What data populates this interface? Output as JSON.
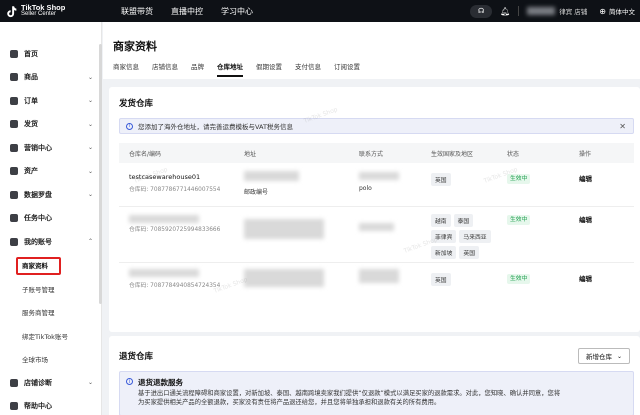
{
  "topbar": {
    "logo_line1": "TikTok Shop",
    "logo_line2": "Seller Center",
    "nav": [
      "联盟带货",
      "直播中控",
      "学习中心"
    ],
    "shop_suffix": "律宾 店铺",
    "language": "简体中文",
    "icons": [
      "headset-icon",
      "bell-icon",
      "globe-icon"
    ]
  },
  "sidebar": {
    "items": [
      {
        "label": "首页",
        "icon": "home-icon",
        "chevron": ""
      },
      {
        "label": "商品",
        "icon": "product-icon",
        "chevron": "⌄"
      },
      {
        "label": "订单",
        "icon": "order-icon",
        "chevron": "⌄"
      },
      {
        "label": "发货",
        "icon": "shipping-icon",
        "chevron": "⌄"
      },
      {
        "label": "营销中心",
        "icon": "marketing-icon",
        "chevron": "⌄"
      },
      {
        "label": "资产",
        "icon": "asset-icon",
        "chevron": "⌄"
      },
      {
        "label": "数据罗盘",
        "icon": "compass-icon",
        "chevron": "⌄"
      },
      {
        "label": "任务中心",
        "icon": "task-icon",
        "chevron": ""
      },
      {
        "label": "我的账号",
        "icon": "account-icon",
        "chevron": "⌃"
      }
    ],
    "sub_items": [
      "商家资料",
      "子账号管理",
      "服务商管理",
      "绑定TikTok账号",
      "全球市场"
    ],
    "bottom_items": [
      {
        "label": "店铺诊断",
        "icon": "diagnosis-icon",
        "chevron": "⌄"
      },
      {
        "label": "帮助中心",
        "icon": "help-icon",
        "chevron": ""
      }
    ]
  },
  "page": {
    "title": "商家资料",
    "tabs": [
      "商家信息",
      "店铺信息",
      "品牌",
      "仓库地址",
      "假期设置",
      "支付信息",
      "订阅设置"
    ],
    "active_tab": "仓库地址"
  },
  "shipping_warehouse": {
    "title": "发货仓库",
    "banner": "您添加了海外仓地址，请完善运费模板与VAT税务信息",
    "columns": [
      "仓库名/编码",
      "地址",
      "联系方式",
      "生效国家及地区",
      "状态",
      "操作"
    ],
    "rows": [
      {
        "name": "testcasewarehouse01",
        "code": "仓库码: 7087786771446007554",
        "address": "邮政编号",
        "contact": "polo",
        "regions": [
          "英国"
        ],
        "status": "生效中",
        "action": "编辑"
      },
      {
        "name": "",
        "code": "仓库码: 7085920725994833666",
        "address": "",
        "contact": "",
        "regions": [
          "越南",
          "泰国",
          "菲律宾",
          "马来西亚",
          "新加坡",
          "英国"
        ],
        "status": "生效中",
        "action": "编辑"
      },
      {
        "name": "",
        "code": "仓库码: 7087784940854724354",
        "address": "",
        "contact": "",
        "regions": [
          "英国"
        ],
        "status": "生效中",
        "action": "编辑"
      }
    ]
  },
  "return_warehouse": {
    "title": "退货仓库",
    "add_button": "新增仓库",
    "notice_title": "退货退款服务",
    "notice_line1": "基于进出口通关流程障碍和商家设置，对新加坡、泰国、越南跨境卖家我们提供“仅退款”模式以满足买家的退款需求。对此，您知晓、确认并同意，您将",
    "notice_line2": "为买家提供相关产品的全额退款，买家没有责任将产品退还给您，并且您将单独承担和退款有关的所有费用。"
  },
  "watermark_text": "TikTok Shop",
  "colors": {
    "accent_status": "#1a9e4a",
    "highlight_box": "#e02020",
    "topbar": "#0e1116"
  }
}
